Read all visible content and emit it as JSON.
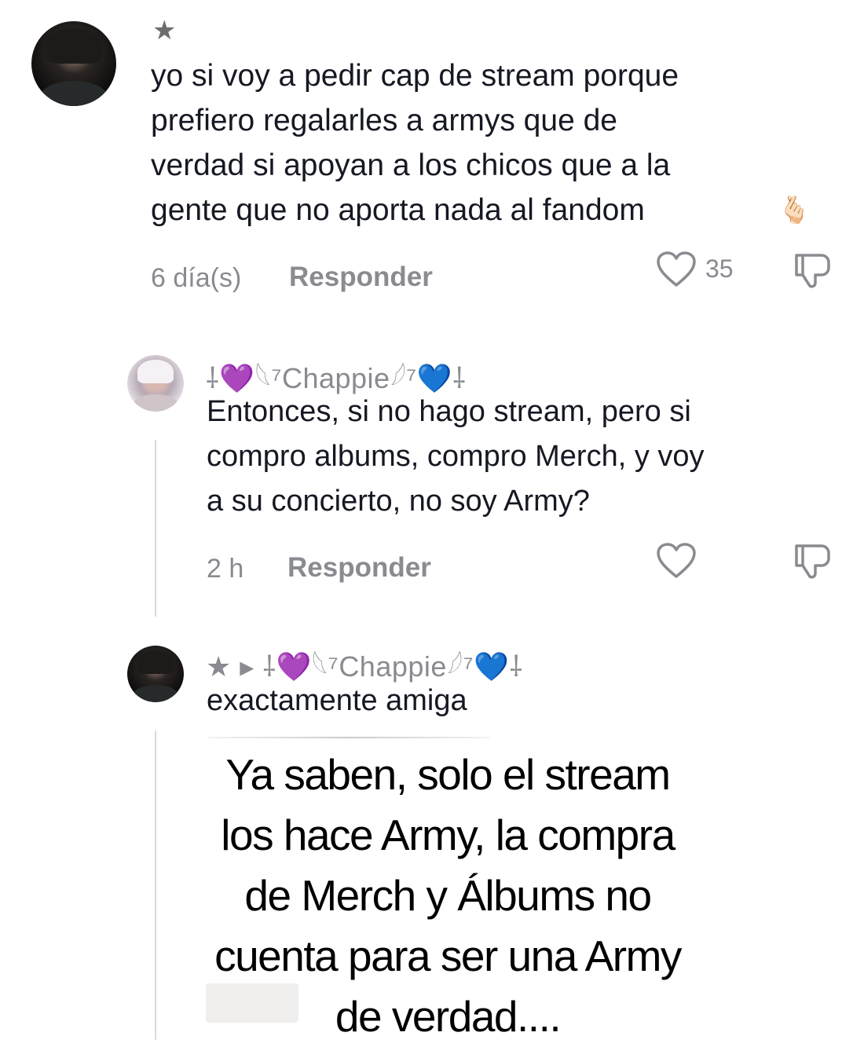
{
  "comment": {
    "badge": "★",
    "text_lines": [
      "yo si voy a pedir cap de stream porque",
      "prefiero regalarles a armys que de",
      "verdad si apoyan a los chicos que a la",
      "gente que no aporta nada al fandom"
    ],
    "emoji": "🫰🏻",
    "time": "6 día(s)",
    "reply_label": "Responder",
    "like_count": "35"
  },
  "reply1": {
    "username": "⸸💜𓆩⁷Chappie𓆪⁷💙⸸",
    "text_lines": [
      "Entonces, si no hago stream, pero si",
      "compro albums, compro Merch, y voy",
      "a su concierto, no soy Army?"
    ],
    "time": "2 h",
    "reply_label": "Responder"
  },
  "reply2": {
    "username": "★ ▸ ⸸💜𓆩⁷Chappie𓆪⁷💙⸸",
    "text": "exactamente amiga"
  },
  "overlay": {
    "lines": [
      "Ya saben, solo el stream",
      "los hace Army, la compra",
      "de Merch y Álbums no",
      "cuenta para ser una Army",
      "de verdad...."
    ]
  }
}
